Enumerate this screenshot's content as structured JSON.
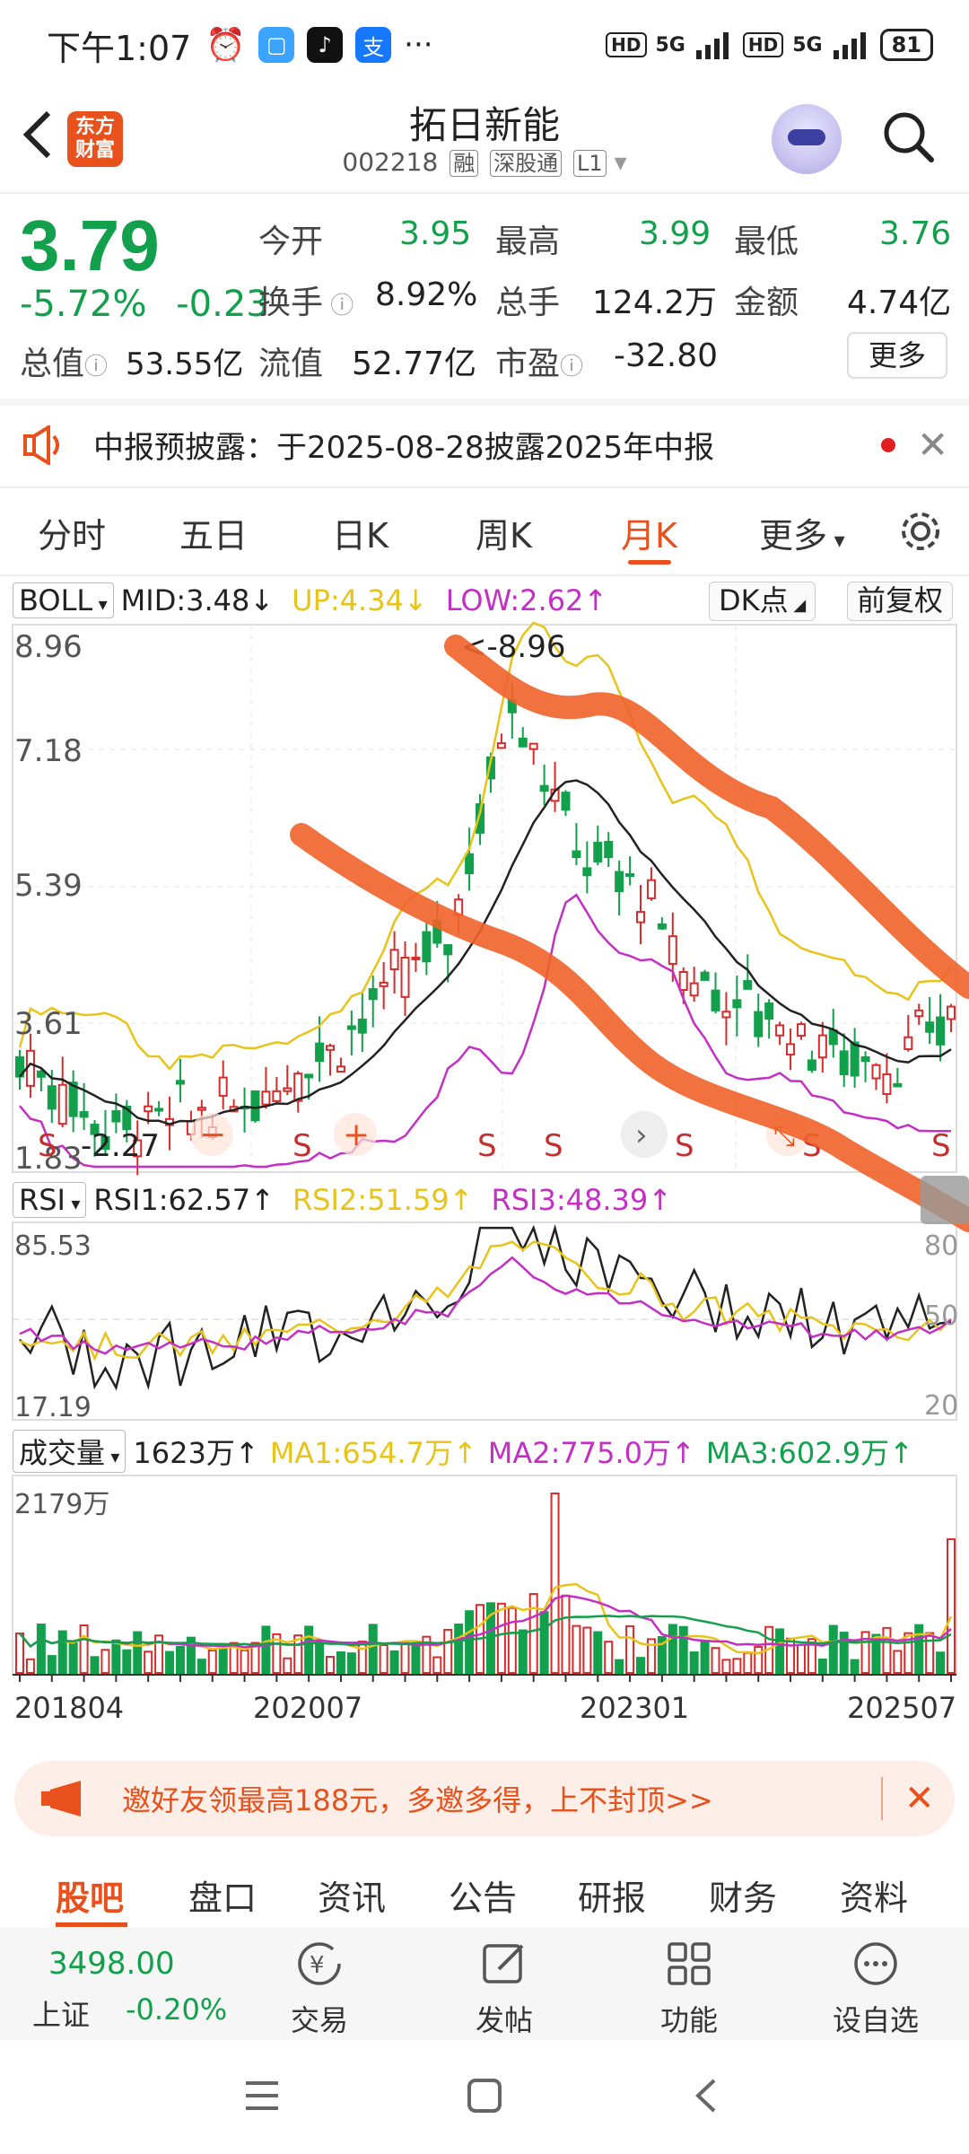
{
  "status_bar": {
    "time": "下午1:07",
    "net1": "5G",
    "net2": "5G",
    "hd": "HD",
    "battery": "81"
  },
  "header": {
    "back_label": "‹",
    "logo_line1": "东方",
    "logo_line2": "财富",
    "stock_name": "拓日新能",
    "stock_code": "002218",
    "tags": [
      "融",
      "深股通",
      "L1"
    ]
  },
  "quote": {
    "price": "3.79",
    "change_pct": "-5.72%",
    "change_abs": "-0.23",
    "rows": [
      [
        {
          "label": "今开",
          "value": "3.95"
        },
        {
          "label": "最高",
          "value": "3.99"
        },
        {
          "label": "最低",
          "value": "3.76"
        }
      ],
      [
        {
          "label": "换手",
          "value": "8.92%"
        },
        {
          "label": "总手",
          "value": "124.2万"
        },
        {
          "label": "金额",
          "value": "4.74亿"
        }
      ],
      [
        {
          "label": "总值",
          "value": "53.55亿"
        },
        {
          "label": "流值",
          "value": "52.77亿"
        },
        {
          "label": "市盈",
          "value": "-32.80"
        }
      ]
    ],
    "more_label": "更多"
  },
  "notice": {
    "text": "中报预披露：于2025-08-28披露2025年中报"
  },
  "period_tabs": {
    "items": [
      "分时",
      "五日",
      "日K",
      "周K",
      "月K",
      "更多"
    ],
    "active": "月K"
  },
  "boll": {
    "selector": "BOLL",
    "mid": "MID:3.48",
    "up": "UP:4.34",
    "low": "LOW:2.62",
    "dk_label": "DK点",
    "fq_label": "前复权",
    "y_labels": [
      "8.96",
      "7.18",
      "5.39",
      "3.61",
      "1.83"
    ],
    "high_mark": "<-8.96",
    "low_mark": "-2.27",
    "s_marker": "S"
  },
  "rsi": {
    "selector": "RSI",
    "rsi1": "RSI1:62.57",
    "rsi2": "RSI2:51.59",
    "rsi3": "RSI3:48.39",
    "y_left": [
      "85.53",
      "17.19"
    ],
    "y_right": [
      "80",
      "50",
      "20"
    ]
  },
  "volume": {
    "selector": "成交量",
    "vol": "1623万",
    "ma1": "MA1:654.7万",
    "ma2": "MA2:775.0万",
    "ma3": "MA3:602.9万",
    "y_max": "2179万",
    "x_labels": [
      "201804",
      "202007",
      "202301",
      "202507"
    ]
  },
  "invite": {
    "text": "邀好友领最高188元，多邀多得，上不封顶>>"
  },
  "bottom_tabs": {
    "items": [
      "股吧",
      "盘口",
      "资讯",
      "公告",
      "研报",
      "财务",
      "资料"
    ],
    "active": "股吧"
  },
  "toolbar": {
    "index_value": "3498.00",
    "index_name": "上证",
    "index_change": "-0.20%",
    "tools": [
      {
        "label": "交易",
        "icon": "trade-icon"
      },
      {
        "label": "发帖",
        "icon": "post-icon"
      },
      {
        "label": "功能",
        "icon": "apps-icon"
      },
      {
        "label": "设自选",
        "icon": "more-icon"
      }
    ]
  },
  "colors": {
    "up": "#d62c2c",
    "down": "#12a04c",
    "accent": "#e8501c",
    "yellow": "#e8c41a",
    "purple": "#c42fc4"
  }
}
